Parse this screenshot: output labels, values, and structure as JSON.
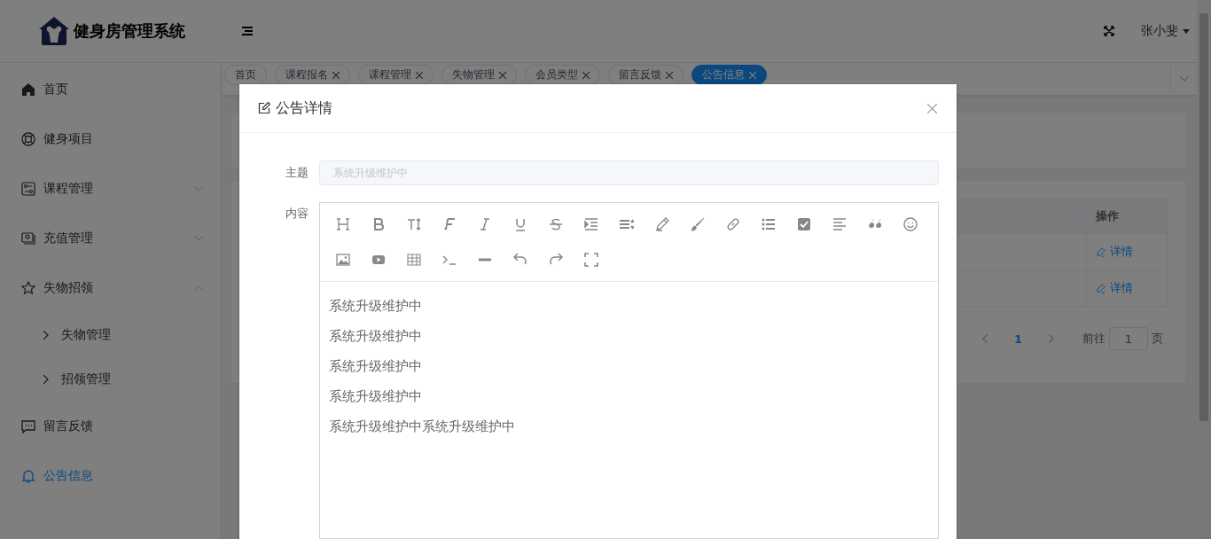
{
  "header": {
    "title": "健身房管理系统",
    "user": "张小斐"
  },
  "sidebar": {
    "items": [
      {
        "label": "首页",
        "selected": false
      },
      {
        "label": "健身项目",
        "selected": false
      },
      {
        "label": "课程管理",
        "selected": false,
        "expanded": false
      },
      {
        "label": "充值管理",
        "selected": false,
        "expanded": false
      },
      {
        "label": "失物招领",
        "selected": false,
        "expanded": true,
        "children": [
          {
            "label": "失物管理",
            "selected": false
          },
          {
            "label": "招领管理",
            "selected": false
          }
        ]
      },
      {
        "label": "留言反馈",
        "selected": false
      },
      {
        "label": "公告信息",
        "selected": true
      }
    ]
  },
  "tabs": [
    {
      "label": "首页",
      "closable": false,
      "selected": false
    },
    {
      "label": "课程报名",
      "closable": true,
      "selected": false
    },
    {
      "label": "课程管理",
      "closable": true,
      "selected": false
    },
    {
      "label": "失物管理",
      "closable": true,
      "selected": false
    },
    {
      "label": "会员类型",
      "closable": true,
      "selected": false
    },
    {
      "label": "留言反馈",
      "closable": true,
      "selected": false
    },
    {
      "label": "公告信息",
      "closable": true,
      "selected": true
    }
  ],
  "table": {
    "columns": [
      "操作"
    ],
    "rows": [
      {
        "action": "详情"
      },
      {
        "action": "详情"
      }
    ]
  },
  "pagination": {
    "page": "1",
    "goto_label": "前往",
    "goto_value": "1",
    "suffix": "页"
  },
  "dialog": {
    "title": "公告详情",
    "subject": {
      "label": "主题",
      "value": "系统升级维护中",
      "disabled": true
    },
    "content": {
      "label": "内容",
      "lines": [
        "系统升级维护中",
        "系统升级维护中",
        "系统升级维护中",
        "系统升级维护中",
        "系统升级维护中系统升级维护中"
      ]
    }
  }
}
